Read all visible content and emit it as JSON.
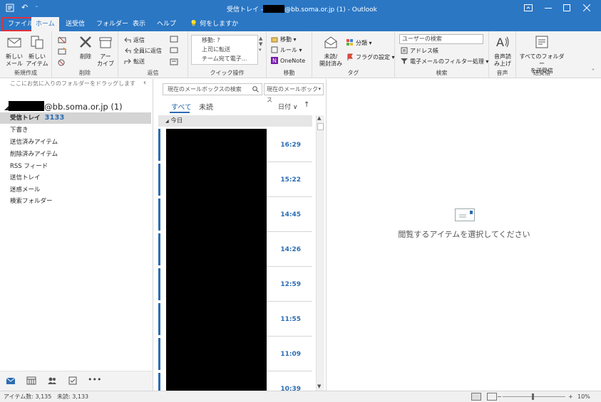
{
  "titlebar": {
    "title_prefix": "受信トレイ -",
    "title_suffix": "@bb.soma.or.jp (1)  -  Outlook",
    "qat_undo": "↶",
    "qat_more": "⁼"
  },
  "tabs": {
    "file": "ファイル",
    "home": "ホーム",
    "send_receive": "送受信",
    "folder": "フォルダー",
    "view": "表示",
    "help": "ヘルプ",
    "tell_me": "何をしますか"
  },
  "ribbon": {
    "new": {
      "new_mail": "新しい\nメール",
      "new_items": "新しい\nアイテム",
      "label": "新規作成"
    },
    "delete": {
      "delete": "削除",
      "archive": "アー\nカイブ",
      "label": "削除"
    },
    "respond": {
      "reply": "返信",
      "reply_all": "全員に返信",
      "forward": "転送",
      "label": "返信"
    },
    "quick_steps": {
      "items": [
        "移動: ?",
        "上司に転送",
        "チーム宛て電子..."
      ],
      "label": "クイック操作"
    },
    "move": {
      "move": "移動",
      "rules": "ルール",
      "onenote": "OneNote",
      "label": "移動"
    },
    "tags": {
      "unread_read": "未読/\n開封済み",
      "categorize": "分類",
      "follow_up": "フラグの設定",
      "label": "タグ"
    },
    "find": {
      "search_people": "ユーザーの検索",
      "address_book": "アドレス帳",
      "filter_email": "電子メールのフィルター処理",
      "label": "検索"
    },
    "speech": {
      "read_aloud": "音声読\nみ上げ",
      "label": "音声"
    },
    "send_receive": {
      "send_all": "すべてのフォルダー\nを送受信",
      "label": "送受信"
    }
  },
  "folderpane": {
    "favorites_hint": "ここにお気に入りのフォルダーをドラッグします",
    "account_suffix": "@bb.soma.or.jp (1)",
    "folders": [
      {
        "name": "受信トレイ",
        "count": "3133"
      },
      {
        "name": "下書き"
      },
      {
        "name": "送信済みアイテム"
      },
      {
        "name": "削除済みアイテム"
      },
      {
        "name": "RSS フィード"
      },
      {
        "name": "送信トレイ"
      },
      {
        "name": "迷惑メール"
      },
      {
        "name": "検索フォルダー"
      }
    ]
  },
  "msglist": {
    "search_placeholder": "現在のメールボックスの検索",
    "scope": "現在のメールボックス",
    "filter_all": "すべて",
    "filter_unread": "未読",
    "sort": "日付",
    "group": "今日",
    "times": [
      "16:29",
      "15:22",
      "14:45",
      "14:26",
      "12:59",
      "11:55",
      "11:09",
      "10:39"
    ]
  },
  "reading": {
    "empty_message": "閲覧するアイテムを選択してください"
  },
  "status": {
    "items": "アイテム数: 3,135",
    "unread": "未読: 3,133",
    "zoom": "10%"
  },
  "colors": {
    "accent": "#2b77c4",
    "unread_time": "#2b6cb3",
    "file_highlight": "#e0303a"
  }
}
